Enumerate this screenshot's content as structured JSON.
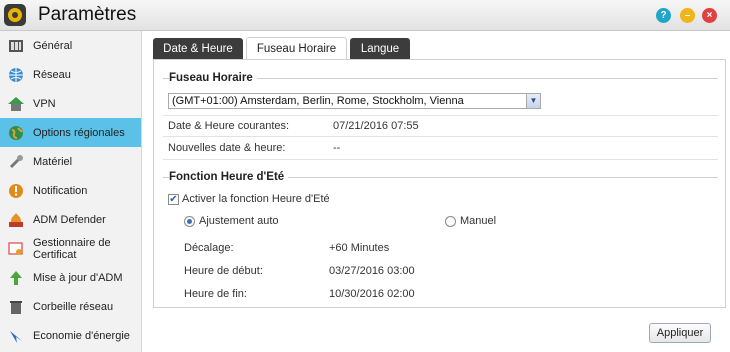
{
  "window": {
    "title": "Paramètres",
    "help_glyph": "?",
    "minimize_glyph": "–",
    "close_glyph": "×"
  },
  "sidebar": {
    "items": [
      {
        "label": "Général",
        "icon": "general-icon"
      },
      {
        "label": "Réseau",
        "icon": "network-globe-icon"
      },
      {
        "label": "VPN",
        "icon": "vpn-house-icon"
      },
      {
        "label": "Options régionales",
        "icon": "regional-globe-icon",
        "active": true
      },
      {
        "label": "Matériel",
        "icon": "hardware-wrench-icon"
      },
      {
        "label": "Notification",
        "icon": "notification-alert-icon"
      },
      {
        "label": "ADM Defender",
        "icon": "defender-firewall-icon"
      },
      {
        "label": "Gestionnaire de Certificat",
        "icon": "certificate-icon"
      },
      {
        "label": "Mise à jour d'ADM",
        "icon": "update-arrow-icon"
      },
      {
        "label": "Corbeille réseau",
        "icon": "recycle-bin-icon"
      },
      {
        "label": "Economie d'énergie",
        "icon": "energy-saving-icon"
      }
    ]
  },
  "tabs": [
    {
      "label": "Date & Heure"
    },
    {
      "label": "Fuseau Horaire",
      "active": true
    },
    {
      "label": "Langue"
    }
  ],
  "timezone": {
    "section_title": "Fuseau Horaire",
    "selected": "(GMT+01:00) Amsterdam, Berlin, Rome, Stockholm, Vienna",
    "current_label": "Date & Heure courantes:",
    "current_value": "07/21/2016  07:55",
    "new_label": "Nouvelles date & heure:",
    "new_value": "--"
  },
  "dst": {
    "section_title": "Fonction Heure d'Eté",
    "enable_label": "Activer la fonction Heure d'Eté",
    "enable_checked": true,
    "auto_label": "Ajustement auto",
    "auto_selected": true,
    "manual_label": "Manuel",
    "offset_label": "Décalage:",
    "offset_value": "+60 Minutes",
    "start_label": "Heure de début:",
    "start_value": "03/27/2016   03:00",
    "end_label": "Heure de fin:",
    "end_value": "10/30/2016   02:00"
  },
  "actions": {
    "apply_label": "Appliquer"
  },
  "colors": {
    "active_sidebar": "#5bc1e8",
    "tab_dark": "#3c3c3c"
  }
}
